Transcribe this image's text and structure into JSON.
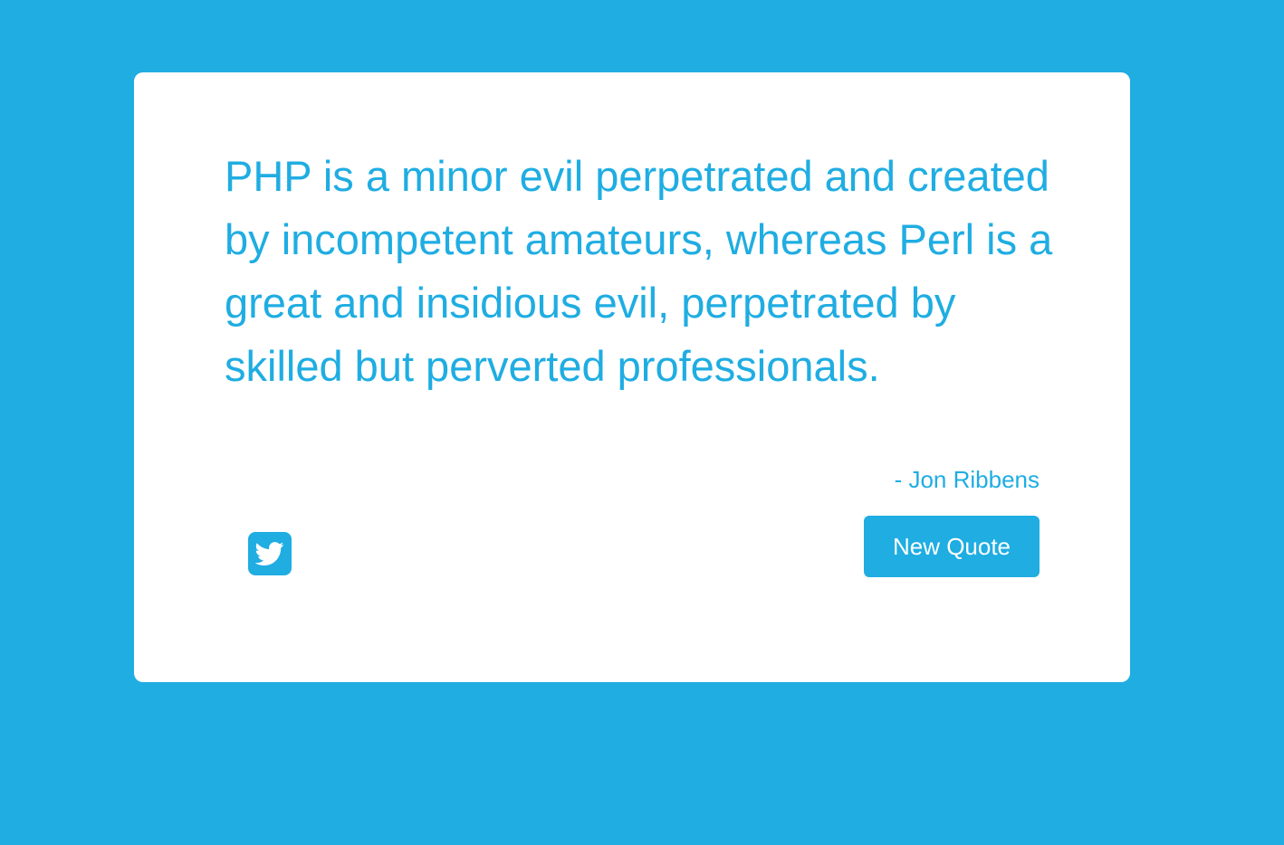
{
  "colors": {
    "background": "#1fade2",
    "card": "#ffffff",
    "accent": "#1fade2",
    "button_text": "#ffffff"
  },
  "quote": {
    "text": "PHP is a minor evil perpetrated and created by incompetent amateurs, whereas Perl is a great and insidious evil, perpetrated by skilled but perverted professionals.",
    "author": "- Jon Ribbens"
  },
  "actions": {
    "tweet_icon": "twitter-icon",
    "new_quote_label": "New Quote"
  }
}
